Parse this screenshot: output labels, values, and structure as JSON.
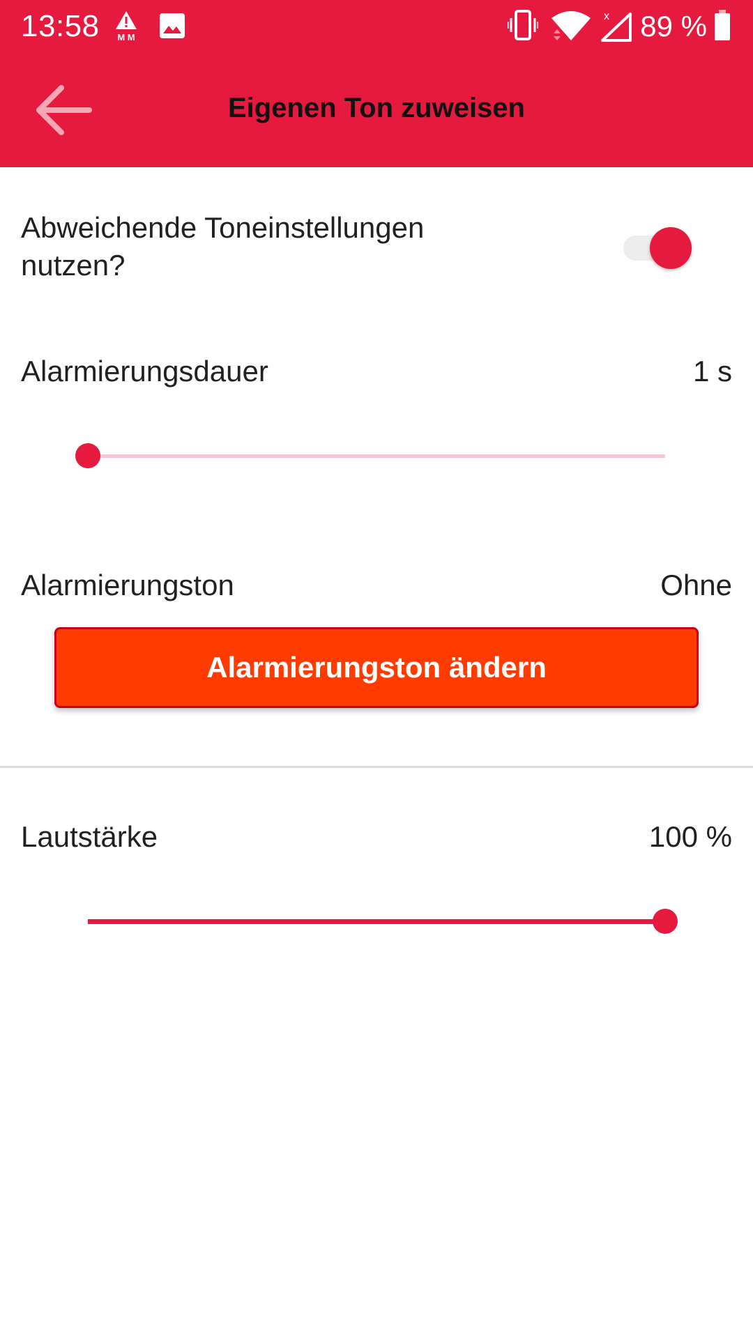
{
  "status_bar": {
    "time": "13:58",
    "battery_text": "89 %",
    "icons": [
      "alert-mm-icon",
      "image-icon",
      "vibrate-icon",
      "wifi-icon",
      "no-signal-icon",
      "battery-icon"
    ],
    "alert_icon_text": "M M",
    "signal_icon_text": "x"
  },
  "toolbar": {
    "title": "Eigenen Ton zuweisen",
    "back_icon": "arrow-back-icon"
  },
  "settings": {
    "custom_tone": {
      "label": "Abweichende Toneinstellungen nutzen?",
      "enabled": true
    },
    "alarm_duration": {
      "label": "Alarmierungsdauer",
      "value_text": "1 s",
      "slider_fraction": 0.0
    },
    "alarm_tone": {
      "label": "Alarmierungston",
      "value_text": "Ohne",
      "button_label": "Alarmierungston ändern"
    },
    "volume": {
      "label": "Lautstärke",
      "value_text": "100 %",
      "slider_fraction": 1.0
    }
  },
  "colors": {
    "brand": "#e6193f",
    "button": "#ff3b00",
    "slider_track": "#f7c4cf",
    "text": "#212121"
  }
}
